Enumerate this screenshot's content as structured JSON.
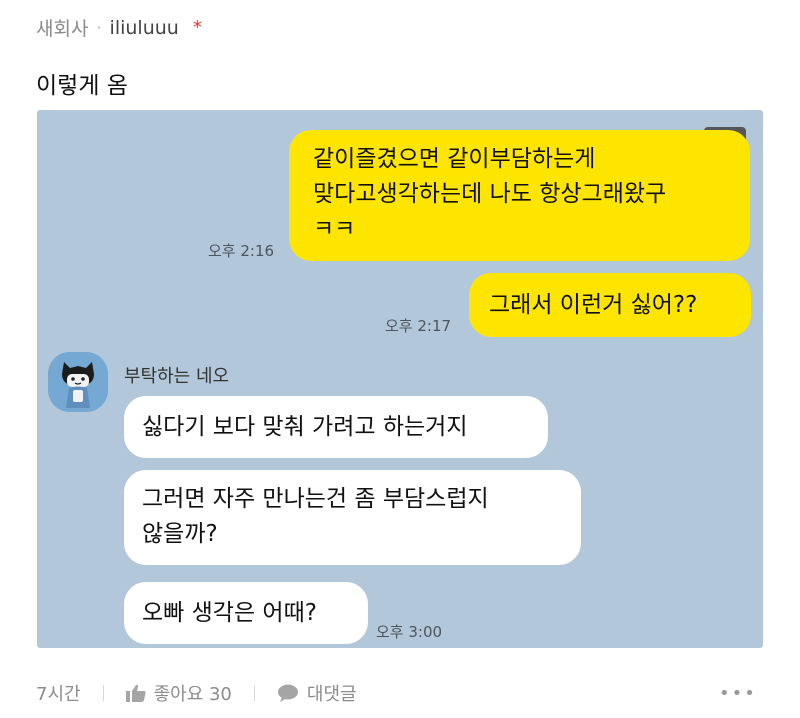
{
  "post": {
    "board": "새회사",
    "separator": "·",
    "author": "iliuluuu",
    "star": "*",
    "title": "이렇게 옴"
  },
  "chat": {
    "background": "#b2c7d9",
    "expand_icon": "expand-icon",
    "messages": [
      {
        "side": "mine",
        "lines": [
          "같이즐겼으면 같이부담하는게",
          "맞다고생각하는데 나도 항상그래왔구",
          "ㅋㅋ"
        ],
        "time": "오후 2:16"
      },
      {
        "side": "mine",
        "lines": [
          "그래서 이런거 싫어??"
        ],
        "time": "오후 2:17"
      },
      {
        "side": "theirs",
        "sender": "부탁하는 네오",
        "lines": [
          "싫다기 보다 맞춰 가려고 하는거지"
        ]
      },
      {
        "side": "theirs",
        "lines": [
          "그러면 자주 만나는건 좀 부담스럽지",
          "않을까?"
        ]
      },
      {
        "side": "theirs",
        "lines": [
          "오빠 생각은 어때?"
        ],
        "time": "오후 3:00"
      }
    ]
  },
  "footer": {
    "time": "7시간",
    "like_icon": "thumbs-up-icon",
    "like_label": "좋아요 30",
    "comment_icon": "speech-bubble-icon",
    "comment_label": "대댓글",
    "more_icon": "more-dots-icon",
    "more": "•••"
  },
  "colors": {
    "mine_bubble": "#fee500",
    "theirs_bubble": "#ffffff",
    "accent_star": "#e0342e"
  }
}
